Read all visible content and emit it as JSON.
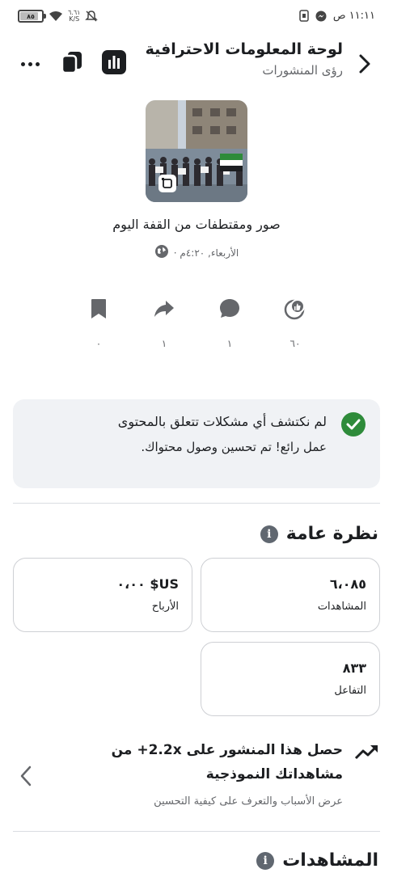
{
  "status_bar": {
    "time": "١١:١١ ص",
    "battery": "٨٥",
    "net_speed_value": "٦.٦١",
    "net_speed_unit": "K/S"
  },
  "header": {
    "title": "لوحة المعلومات الاحترافية",
    "subtitle": "رؤى المنشورات"
  },
  "post": {
    "title": "صور ومقتطفات من القفة اليوم",
    "date": "الأربعاء, ٤:٢٠م ·"
  },
  "post_stats": {
    "reactions": "٦٠",
    "comments": "١",
    "shares": "١",
    "saves": "٠"
  },
  "content_check": {
    "title": "لم نكتشف أي مشكلات تتعلق بالمحتوى",
    "subtitle": "عمل رائع! تم تحسين وصول محتواك."
  },
  "overview": {
    "title": "نظرة عامة",
    "metrics": [
      {
        "value": "٦،٠٨٥",
        "label": "المشاهدات"
      },
      {
        "value": "US$ ٠،٠٠",
        "label": "الأرباح"
      },
      {
        "value": "٨٣٣",
        "label": "التفاعل"
      }
    ]
  },
  "insight": {
    "line1": "حصل هذا المنشور على 2.2x+ من",
    "line2": "مشاهداتك النموذجية",
    "subtitle": "عرض الأسباب والتعرف على كيفية التحسين"
  },
  "views_section": {
    "title": "المشاهدات"
  },
  "colors": {
    "accent_green": "#2e8b3a",
    "muted_text": "#65676b",
    "card_bg": "#f0f2f5"
  }
}
